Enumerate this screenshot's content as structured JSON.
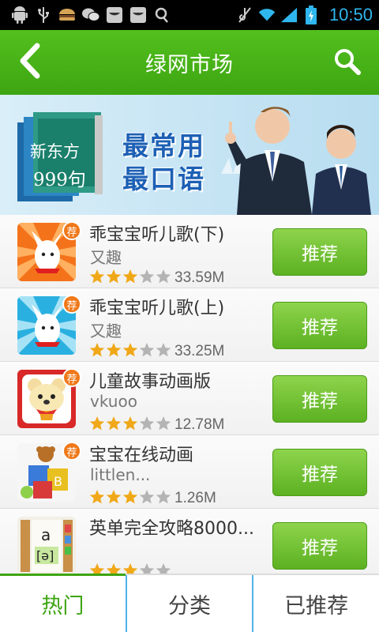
{
  "status_bar": {
    "time": "10:50",
    "icons": [
      "android-icon",
      "usb-icon",
      "burger-icon",
      "wechat-icon",
      "watermelon-icon",
      "watermelon-icon",
      "headset-icon",
      "mute-icon",
      "wifi-icon",
      "signal-icon",
      "battery-charging-icon"
    ]
  },
  "header": {
    "title": "绿网市场",
    "back_icon": "back-chevron-icon",
    "search_icon": "search-icon"
  },
  "banner": {
    "book_title_line1": "新东方",
    "book_title_line2": "999句",
    "slogan_line1": "最常用",
    "slogan_line2": "最口语"
  },
  "apps": [
    {
      "name": "乖宝宝听儿歌(下)",
      "developer": "又趣",
      "rating": 3,
      "max_rating": 5,
      "size": "33.59M",
      "badge": "荐",
      "button_label": "推荐",
      "icon": "dog-orange-icon"
    },
    {
      "name": "乖宝宝听儿歌(上)",
      "developer": "又趣",
      "rating": 3,
      "max_rating": 5,
      "size": "33.25M",
      "badge": "荐",
      "button_label": "推荐",
      "icon": "dog-blue-icon"
    },
    {
      "name": "儿童故事动画版",
      "developer": "vkuoo",
      "rating": 3,
      "max_rating": 5,
      "size": "12.78M",
      "badge": "荐",
      "button_label": "推荐",
      "icon": "bear-red-icon"
    },
    {
      "name": "宝宝在线动画",
      "developer": "littlen...",
      "rating": 3,
      "max_rating": 5,
      "size": "1.26M",
      "badge": "荐",
      "button_label": "推荐",
      "icon": "toy-blocks-icon"
    },
    {
      "name": "英单完全攻略8000...",
      "developer": "",
      "rating": 3,
      "max_rating": 5,
      "size": "",
      "badge": "",
      "button_label": "推荐",
      "icon": "phonetic-book-icon"
    }
  ],
  "tabs": [
    {
      "label": "热门",
      "active": true
    },
    {
      "label": "分类",
      "active": false
    },
    {
      "label": "已推荐",
      "active": false
    }
  ],
  "colors": {
    "header_green": "#45ad17",
    "button_green": "#6cc232",
    "tab_active": "#3ea512",
    "badge_orange": "#f07818",
    "star_gold": "#f0a818",
    "star_grey": "#b4b4b4",
    "time_blue": "#2fb6ee"
  }
}
